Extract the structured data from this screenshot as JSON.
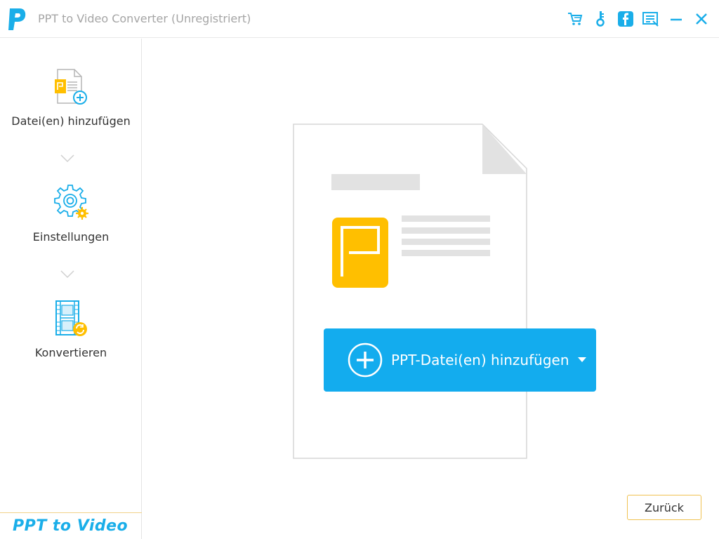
{
  "window": {
    "title": "PPT to Video Converter (Unregistriert)",
    "logo_letter": "P",
    "toolbar_icons": [
      "cart-icon",
      "key-icon",
      "facebook-icon",
      "feedback-icon",
      "minimize-icon",
      "close-icon"
    ]
  },
  "sidebar": {
    "steps": [
      {
        "label": "Datei(en) hinzufügen",
        "icon": "add-file-icon"
      },
      {
        "label": "Einstellungen",
        "icon": "settings-gear-icon"
      },
      {
        "label": "Konvertieren",
        "icon": "convert-film-icon"
      }
    ],
    "brand": "PPT to Video"
  },
  "main": {
    "add_button_label": "PPT-Datei(en) hinzufügen",
    "back_button_label": "Zurück"
  },
  "colors": {
    "accent_blue": "#13acee",
    "brand_orange": "#ffbf00",
    "border_gold": "#f0c251",
    "title_gray": "#a5a5a5"
  }
}
